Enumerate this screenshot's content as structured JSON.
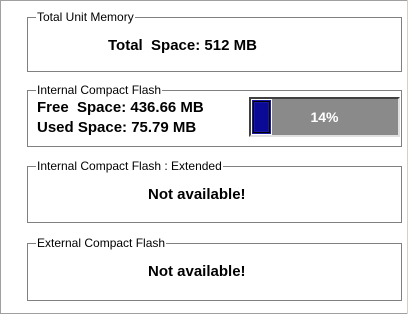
{
  "total_unit_memory": {
    "title": "Total Unit Memory",
    "total_space_text": "Total  Space: 512 MB"
  },
  "internal_cf": {
    "title": "Internal Compact Flash",
    "free_space_text": "Free  Space: 436.66 MB",
    "used_space_text": "Used Space: 75.79 MB",
    "usage_percent_label": "14%",
    "usage_fraction": 0.14,
    "bar_color": "#1a1aa0",
    "track_color": "#8a8a8a"
  },
  "internal_cf_extended": {
    "title": "Internal Compact Flash : Extended",
    "status": "Not available!"
  },
  "external_cf": {
    "title": "External Compact Flash",
    "status": "Not available!"
  }
}
